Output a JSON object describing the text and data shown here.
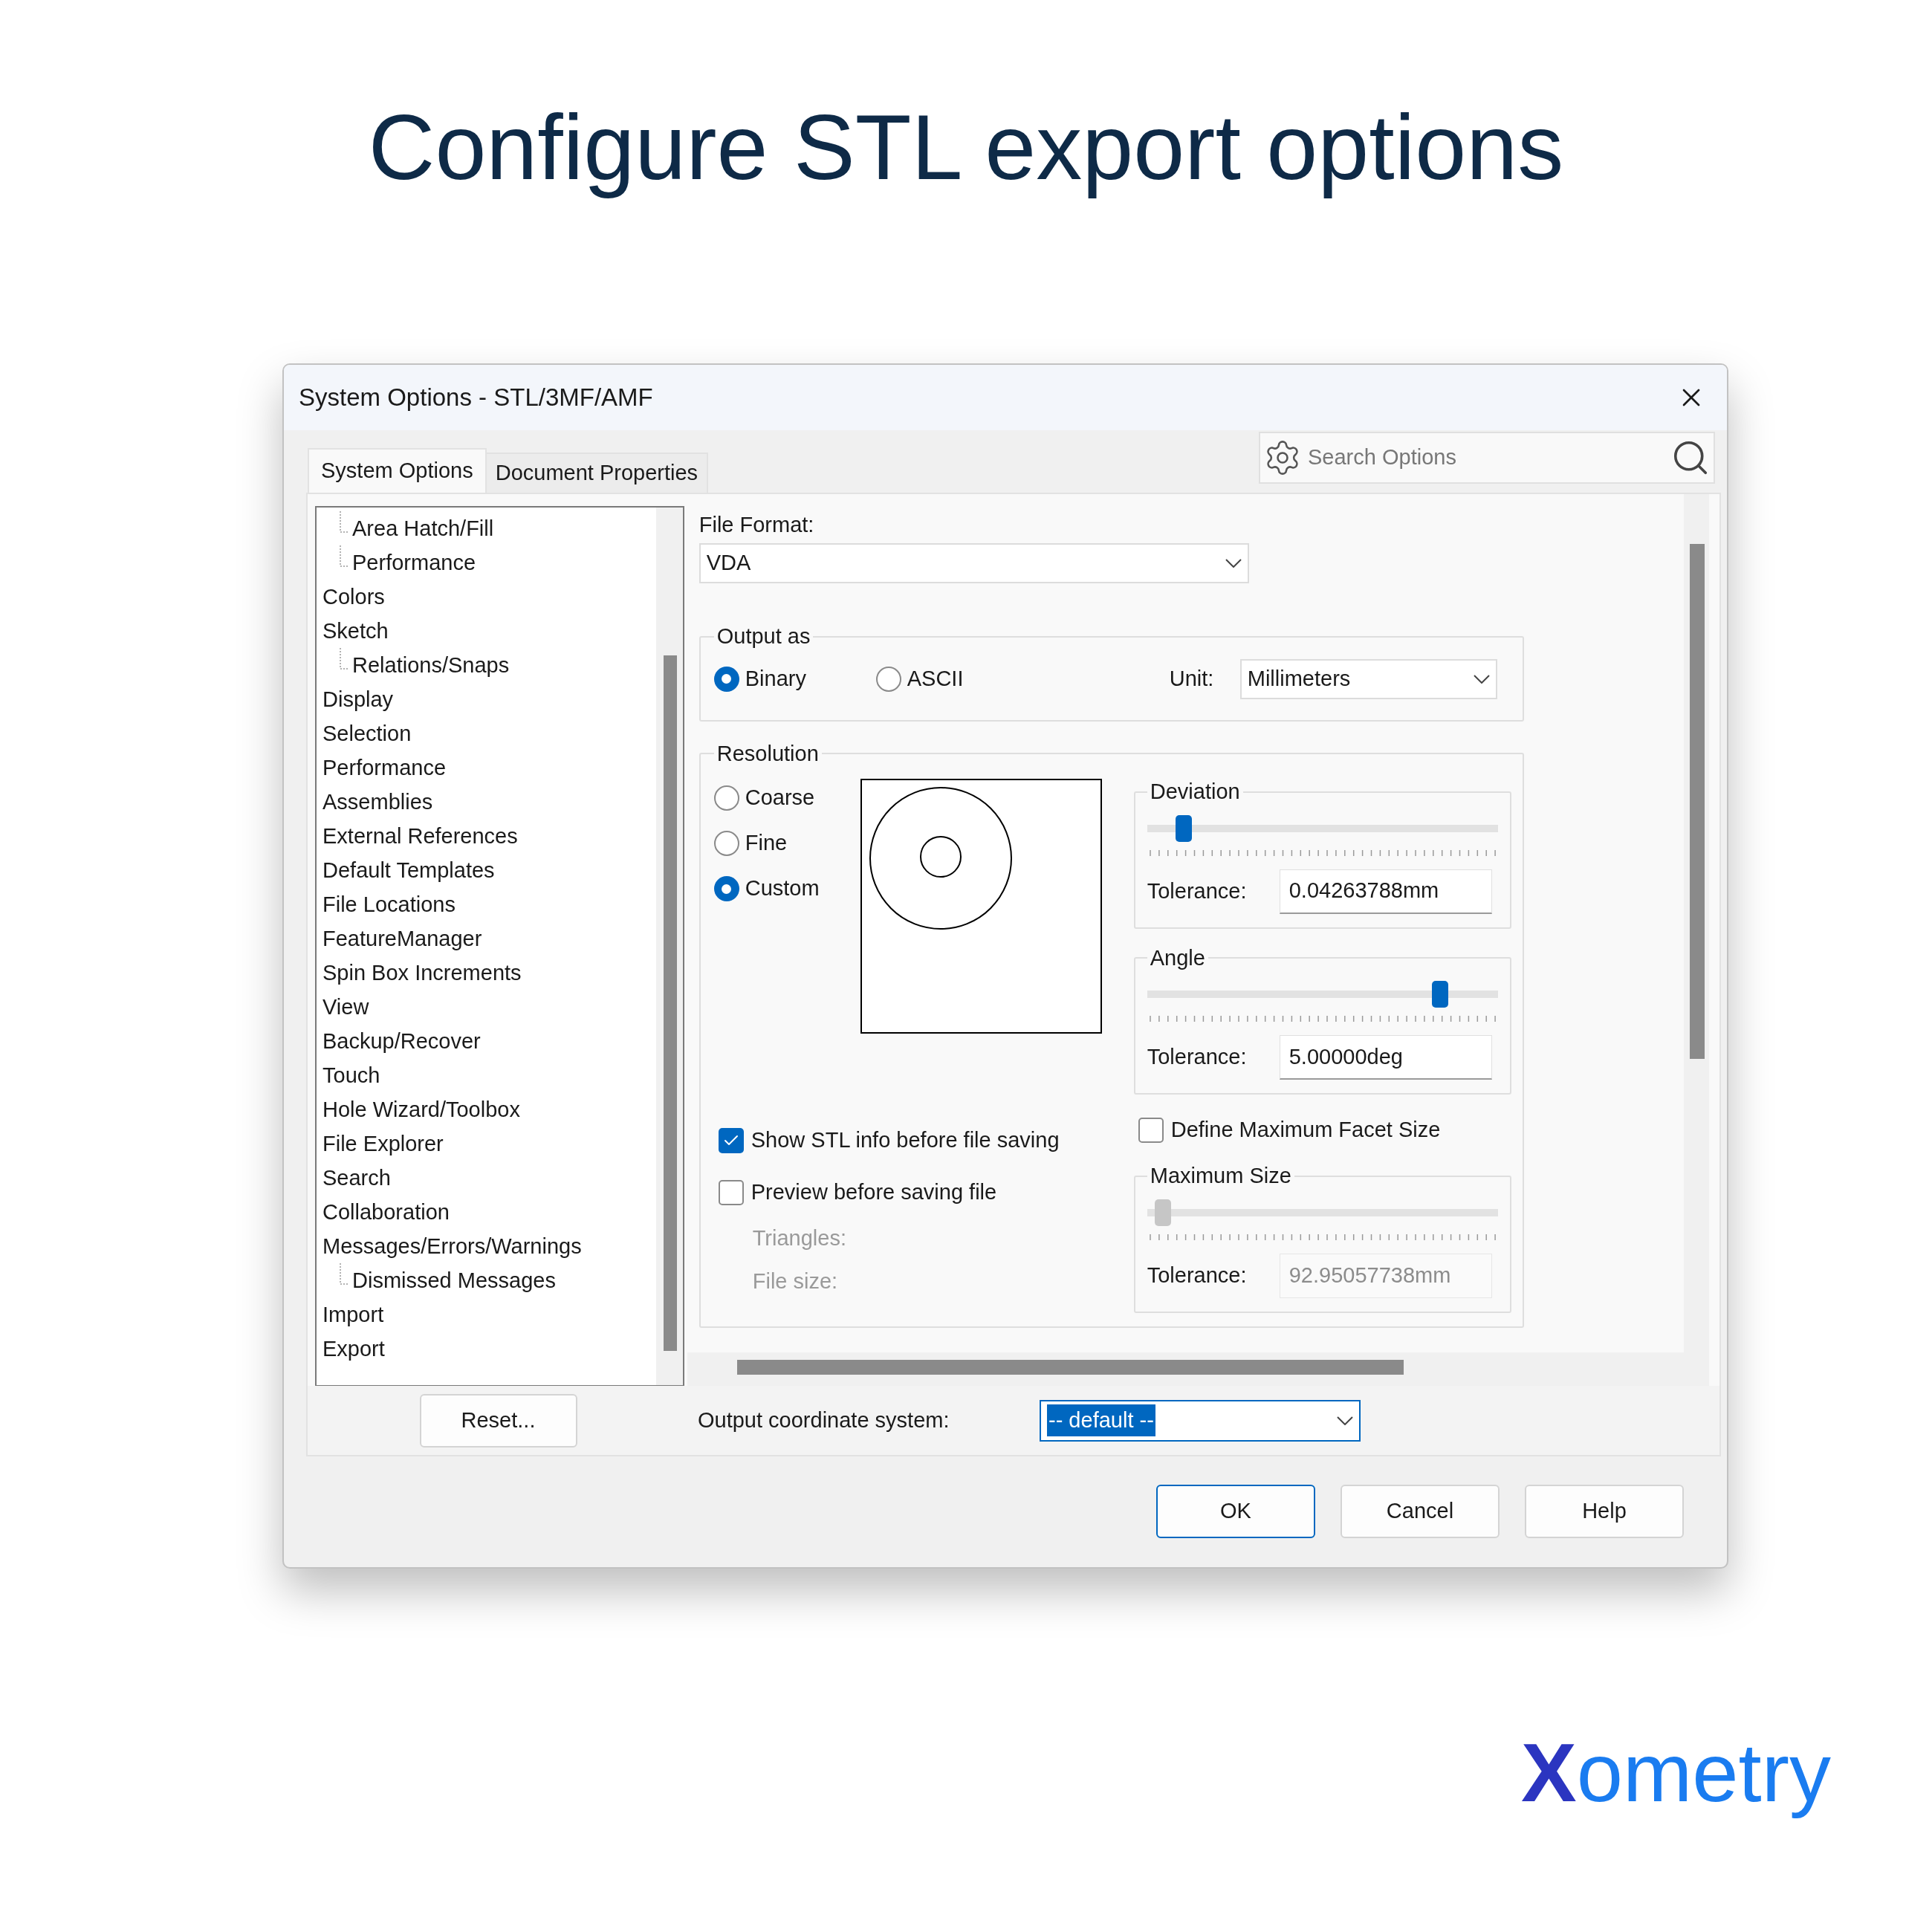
{
  "headline": "Configure STL export options",
  "dialog": {
    "title": "System Options - STL/3MF/AMF",
    "tabs": [
      {
        "label": "System Options",
        "selected": true
      },
      {
        "label": "Document Properties",
        "selected": false
      }
    ],
    "search": {
      "placeholder": "Search Options"
    },
    "tree": [
      {
        "children": [
          {
            "label": "Area Hatch/Fill"
          },
          {
            "label": "Performance"
          }
        ]
      },
      {
        "label": "Colors"
      },
      {
        "label": "Sketch",
        "children": [
          {
            "label": "Relations/Snaps"
          }
        ]
      },
      {
        "label": "Display"
      },
      {
        "label": "Selection"
      },
      {
        "label": "Performance"
      },
      {
        "label": "Assemblies"
      },
      {
        "label": "External References"
      },
      {
        "label": "Default Templates"
      },
      {
        "label": "File Locations"
      },
      {
        "label": "FeatureManager"
      },
      {
        "label": "Spin Box Increments"
      },
      {
        "label": "View"
      },
      {
        "label": "Backup/Recover"
      },
      {
        "label": "Touch"
      },
      {
        "label": "Hole Wizard/Toolbox"
      },
      {
        "label": "File Explorer"
      },
      {
        "label": "Search"
      },
      {
        "label": "Collaboration"
      },
      {
        "label": "Messages/Errors/Warnings",
        "children": [
          {
            "label": "Dismissed Messages"
          }
        ]
      },
      {
        "label": "Import"
      },
      {
        "label": "Export"
      }
    ],
    "file_format": {
      "label": "File Format:",
      "value": "VDA"
    },
    "output_as": {
      "legend": "Output as",
      "options": [
        {
          "label": "Binary",
          "selected": true
        },
        {
          "label": "ASCII",
          "selected": false
        }
      ],
      "unit_label": "Unit:",
      "unit": "Millimeters"
    },
    "resolution": {
      "legend": "Resolution",
      "options": [
        {
          "label": "Coarse",
          "selected": false
        },
        {
          "label": "Fine",
          "selected": false
        },
        {
          "label": "Custom",
          "selected": true
        }
      ],
      "deviation": {
        "legend": "Deviation",
        "level": 0.09,
        "tolerance_label": "Tolerance:",
        "tolerance": "0.04263788mm",
        "disabled": false
      },
      "angle": {
        "legend": "Angle",
        "level": 0.82,
        "tolerance_label": "Tolerance:",
        "tolerance": "5.00000deg",
        "disabled": false
      },
      "show_stl_info": {
        "label": "Show STL info before file saving",
        "checked": true
      },
      "preview": {
        "label": "Preview before saving file",
        "checked": false
      },
      "triangles": "Triangles:",
      "file_size": "File size:",
      "define_max_facet": {
        "label": "Define Maximum Facet Size",
        "checked": false
      },
      "maximum_size": {
        "legend": "Maximum Size",
        "level": 0.03,
        "tolerance_label": "Tolerance:",
        "tolerance": "92.95057738mm",
        "disabled": true
      }
    },
    "reset": "Reset...",
    "coordinate_system": {
      "label": "Output coordinate system:",
      "value": "-- default --"
    },
    "buttons": [
      {
        "label": "OK",
        "kind": "default"
      },
      {
        "label": "Cancel",
        "kind": "normal"
      },
      {
        "label": "Help",
        "kind": "normal"
      }
    ]
  },
  "logo": "Xometry"
}
